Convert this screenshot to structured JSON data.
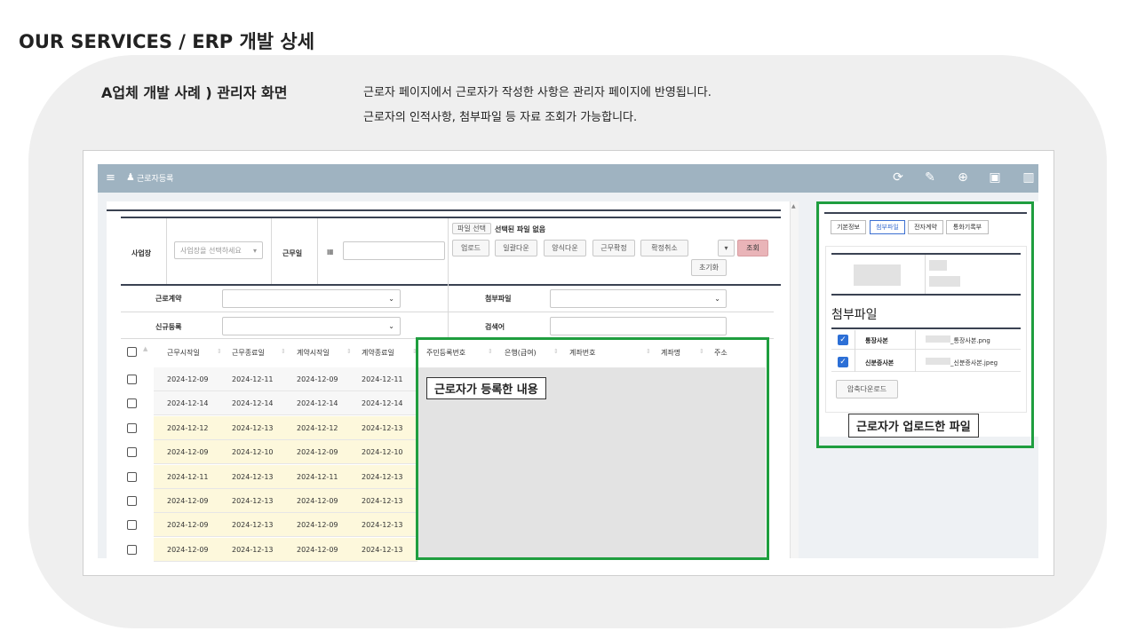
{
  "page": {
    "title": "OUR SERVICES / ERP 개발 상세",
    "case_title": "A업체 개발 사례 ) 관리자 화면",
    "description": [
      "근로자 페이지에서 근로자가 작성한 사항은 관리자 페이지에 반영됩니다.",
      "근로자의 인적사항, 첨부파일 등 자료 조회가 가능합니다."
    ]
  },
  "appbar": {
    "menu_icon": "≡",
    "user_icon": "♟",
    "breadcrumb": "근로자등록",
    "tools": [
      "refresh-icon",
      "edit-icon",
      "add-icon",
      "save-icon",
      "delete-icon"
    ]
  },
  "search": {
    "business_label": "사업장",
    "business_placeholder": "사업장을 선택하세요",
    "workday_label": "근무일",
    "calendar_icon": "▦",
    "file_select_button": "파일 선택",
    "file_status": "선택된 파일 없음",
    "buttons": [
      "업로드",
      "일괄다운",
      "양식다운",
      "근무확정",
      "확정취소"
    ],
    "dropdown_arrow": "▾",
    "query_button": "조회",
    "reset_button": "초기화",
    "contract_label": "근로계약",
    "attachment_label": "첨부파일",
    "new_label": "신규등록",
    "keyword_label": "검색어"
  },
  "grid": {
    "columns": [
      "근무시작일",
      "근무종료일",
      "계약시작일",
      "계약종료일",
      "주민등록번호",
      "은행(급여)",
      "계좌번호",
      "계좌명",
      "주소"
    ],
    "rows": [
      {
        "cells": [
          "2024-12-09",
          "2024-12-11",
          "2024-12-09",
          "2024-12-11"
        ],
        "highlight": false
      },
      {
        "cells": [
          "2024-12-14",
          "2024-12-14",
          "2024-12-14",
          "2024-12-14"
        ],
        "highlight": false
      },
      {
        "cells": [
          "2024-12-12",
          "2024-12-13",
          "2024-12-12",
          "2024-12-13"
        ],
        "highlight": true
      },
      {
        "cells": [
          "2024-12-09",
          "2024-12-10",
          "2024-12-09",
          "2024-12-10"
        ],
        "highlight": true
      },
      {
        "cells": [
          "2024-12-11",
          "2024-12-13",
          "2024-12-11",
          "2024-12-13"
        ],
        "highlight": true
      },
      {
        "cells": [
          "2024-12-09",
          "2024-12-13",
          "2024-12-09",
          "2024-12-13"
        ],
        "highlight": true
      },
      {
        "cells": [
          "2024-12-09",
          "2024-12-13",
          "2024-12-09",
          "2024-12-13"
        ],
        "highlight": true
      },
      {
        "cells": [
          "2024-12-09",
          "2024-12-13",
          "2024-12-09",
          "2024-12-13"
        ],
        "highlight": true
      }
    ],
    "highlight_color": "#fdf8dc",
    "callout": "근로자가 등록한 내용"
  },
  "right": {
    "tabs": [
      "기본정보",
      "첨부파일",
      "전자계약",
      "통화기록부"
    ],
    "active_tab": "첨부파일",
    "attachment_title": "첨부파일",
    "files": [
      {
        "label": "통장사본",
        "file": "_통장사본.png",
        "checked": "✓"
      },
      {
        "label": "신분증사본",
        "file": "_신분증사본.jpeg",
        "checked": "✓"
      }
    ],
    "zip_button": "압축다운로드",
    "callout": "근로자가 업로드한 파일"
  },
  "colors": {
    "appbar": "#9fb3c1",
    "highlight": "#1f9e3f",
    "query": "#e9b4b8",
    "checkbox": "#2c6fd6"
  }
}
